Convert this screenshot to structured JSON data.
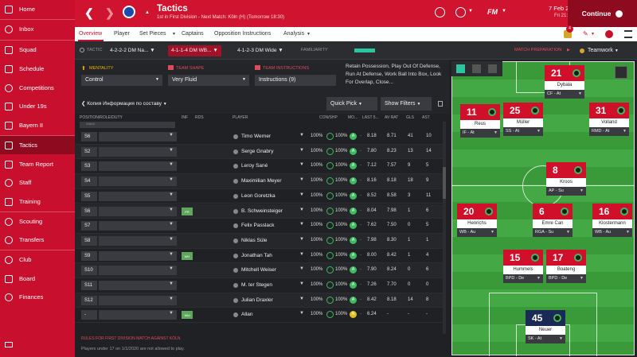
{
  "sidebar": {
    "items": [
      {
        "label": "Home",
        "icon": "home-icon"
      },
      {
        "label": "Inbox",
        "icon": "inbox-icon"
      },
      {
        "label": "Squad",
        "icon": "squad-icon"
      },
      {
        "label": "Schedule",
        "icon": "schedule-icon"
      },
      {
        "label": "Competitions",
        "icon": "competitions-icon"
      },
      {
        "label": "Under 19s",
        "icon": "under19-icon"
      },
      {
        "label": "Bayern II",
        "icon": "bayern2-icon"
      },
      {
        "label": "Tactics",
        "icon": "tactics-icon",
        "active": true
      },
      {
        "label": "Team Report",
        "icon": "team-report-icon"
      },
      {
        "label": "Staff",
        "icon": "staff-icon"
      },
      {
        "label": "Training",
        "icon": "training-icon"
      },
      {
        "label": "Scouting",
        "icon": "scouting-icon"
      },
      {
        "label": "Transfers",
        "icon": "transfers-icon"
      },
      {
        "label": "Club",
        "icon": "club-icon"
      },
      {
        "label": "Board",
        "icon": "board-icon"
      },
      {
        "label": "Finances",
        "icon": "finances-icon"
      }
    ]
  },
  "topbar": {
    "title": "Tactics",
    "subtitle": "1st in First Division - Next Match: Köln (H) (Tomorrow 18:30)",
    "fm_logo": "FM",
    "date": "7 Feb 2020",
    "time": "Fri 21:45",
    "continue_label": "Continue"
  },
  "subnav": {
    "items": [
      "Overview",
      "Player",
      "Set Pieces",
      "Captains",
      "Opposition Instructions",
      "Analysis"
    ],
    "notification_count": "4"
  },
  "tacticbar": {
    "tactic_label": "TACTIC",
    "tactics": [
      "4-2-2-2 DM Na...",
      "4-1-1-4 DM WB...",
      "4-1-2-3 DM Wide"
    ],
    "familiarity_label": "FAMILIARITY",
    "match_prep_label": "MATCH PREPARATION",
    "teamwork_label": "Teamwork"
  },
  "instructions": {
    "mentality_label": "MENTALITY",
    "mentality_value": "Control",
    "shape_label": "TEAM SHAPE",
    "shape_value": "Very Fluid",
    "instructions_label": "TEAM INSTRUCTIONS",
    "instructions_value": "Instructions (9)",
    "summary": "Retain Possession, Play Out Of Defense, Run At Defense, Work Ball Into Box, Look For Overlap, Close..."
  },
  "table": {
    "copy_label": "Копия Информация по составу",
    "quick_pick": "Quick Pick",
    "show_filters": "Show Filters",
    "columns": [
      "POSITION/ROLE/DUTY",
      "INF",
      "RDS",
      "PLAYER",
      "CON/SHP",
      "MO...",
      "LAST 5...",
      "AV RAT",
      "GLS",
      "AST"
    ],
    "attack_label": "Attack",
    "rows": [
      {
        "pos": "S6",
        "inf": "",
        "name": "Timo Werner",
        "con": "100%",
        "shp": "100%",
        "morale": "A",
        "last5": "8.18",
        "avr": "8.71",
        "gls": "41",
        "ast": "10"
      },
      {
        "pos": "S2",
        "inf": "",
        "name": "Serge Gnabry",
        "con": "100%",
        "shp": "100%",
        "morale": "A",
        "last5": "7.80",
        "avr": "8.23",
        "gls": "13",
        "ast": "14"
      },
      {
        "pos": "S3",
        "inf": "",
        "name": "Leroy Sané",
        "con": "100%",
        "shp": "100%",
        "morale": "A",
        "last5": "7.12",
        "avr": "7.57",
        "gls": "9",
        "ast": "5"
      },
      {
        "pos": "S4",
        "inf": "",
        "name": "Maximilian Meyer",
        "con": "100%",
        "shp": "100%",
        "morale": "A",
        "last5": "8.16",
        "avr": "8.18",
        "gls": "18",
        "ast": "9"
      },
      {
        "pos": "S5",
        "inf": "",
        "name": "Leon Goretzka",
        "con": "100%",
        "shp": "100%",
        "morale": "A",
        "last5": "8.52",
        "avr": "8.58",
        "gls": "3",
        "ast": "11"
      },
      {
        "pos": "S6",
        "inf": "PR",
        "name": "B. Schweinsteiger",
        "con": "100%",
        "shp": "100%",
        "morale": "A",
        "last5": "8.04",
        "avr": "7.98",
        "gls": "1",
        "ast": "6"
      },
      {
        "pos": "S7",
        "inf": "",
        "name": "Felix Passlack",
        "con": "100%",
        "shp": "100%",
        "morale": "A",
        "last5": "7.62",
        "avr": "7.50",
        "gls": "0",
        "ast": "5"
      },
      {
        "pos": "S8",
        "inf": "",
        "name": "Niklas Süle",
        "con": "100%",
        "shp": "100%",
        "morale": "A",
        "last5": "7.98",
        "avr": "8.30",
        "gls": "1",
        "ast": "1"
      },
      {
        "pos": "S9",
        "inf": "WH",
        "name": "Jonathan Tah",
        "con": "100%",
        "shp": "100%",
        "morale": "A",
        "last5": "8.00",
        "avr": "8.42",
        "gls": "1",
        "ast": "4"
      },
      {
        "pos": "S10",
        "inf": "",
        "name": "Mitchell Weiser",
        "con": "100%",
        "shp": "100%",
        "morale": "A",
        "last5": "7.90",
        "avr": "8.24",
        "gls": "0",
        "ast": "6"
      },
      {
        "pos": "S11",
        "inf": "",
        "name": "M. ter Stegen",
        "con": "100%",
        "shp": "100%",
        "morale": "A",
        "last5": "7.26",
        "avr": "7.70",
        "gls": "0",
        "ast": "0"
      },
      {
        "pos": "S12",
        "inf": "",
        "name": "Julian Draxler",
        "con": "100%",
        "shp": "100%",
        "morale": "A",
        "last5": "8.42",
        "avr": "8.18",
        "gls": "14",
        "ast": "8"
      },
      {
        "pos": "-",
        "inf": "Wtd",
        "name": "Allan",
        "con": "100%",
        "shp": "100%",
        "morale": "N",
        "last5": "6.24",
        "avr": "-",
        "gls": "-",
        "ast": "-"
      }
    ]
  },
  "footer": {
    "title": "RULES FOR FIRST DIVISION MATCH AGAINST KÖLN",
    "text": "Players under 17 on 1/1/2020 are not allowed to play."
  },
  "pitch": {
    "players": [
      {
        "num": "21",
        "name": "Dybala",
        "role": "CF - At",
        "slot": "cf"
      },
      {
        "num": "11",
        "name": "Reus",
        "role": "IF - At",
        "slot": "lw"
      },
      {
        "num": "25",
        "name": "Müller",
        "role": "SS - At",
        "slot": "ss"
      },
      {
        "num": "31",
        "name": "Volland",
        "role": "RMD - At",
        "slot": "rw"
      },
      {
        "num": "8",
        "name": "Kroos",
        "role": "AP - Su",
        "slot": "cm"
      },
      {
        "num": "20",
        "name": "Henrichs",
        "role": "WB - Au",
        "slot": "lwb"
      },
      {
        "num": "6",
        "name": "Emre Can",
        "role": "RGA - Su",
        "slot": "dm"
      },
      {
        "num": "16",
        "name": "Klostermann",
        "role": "WB - Au",
        "slot": "rwb"
      },
      {
        "num": "15",
        "name": "Hummels",
        "role": "BPD - De",
        "slot": "lcb"
      },
      {
        "num": "17",
        "name": "Boateng",
        "role": "BPD - De",
        "slot": "rcb"
      },
      {
        "num": "45",
        "name": "Neuer",
        "role": "SK - At",
        "slot": "gk"
      }
    ]
  },
  "colors": {
    "brand": "#c8102e",
    "accent_green": "#3dbb5e",
    "familiarity": "#2ec4a0"
  }
}
